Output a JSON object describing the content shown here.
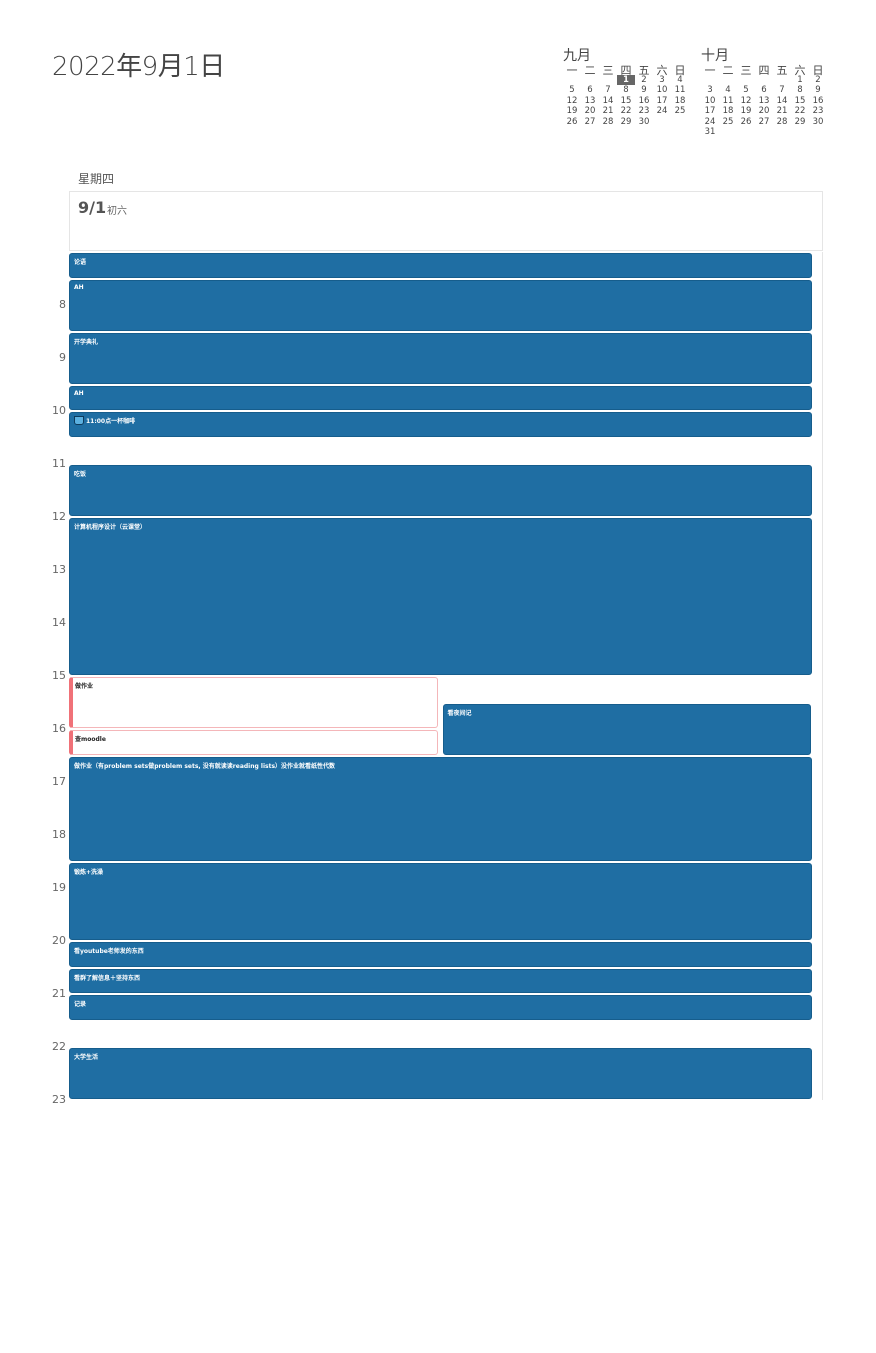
{
  "header": {
    "title": "2022年9月1日"
  },
  "mini_calendars": [
    {
      "title": "九月",
      "weekdays": [
        "一",
        "二",
        "三",
        "四",
        "五",
        "六",
        "日"
      ],
      "days": [
        "",
        "",
        "",
        "1",
        "2",
        "3",
        "4",
        "5",
        "6",
        "7",
        "8",
        "9",
        "10",
        "11",
        "12",
        "13",
        "14",
        "15",
        "16",
        "17",
        "18",
        "19",
        "20",
        "21",
        "22",
        "23",
        "24",
        "25",
        "26",
        "27",
        "28",
        "29",
        "30"
      ],
      "today": "1"
    },
    {
      "title": "十月",
      "weekdays": [
        "一",
        "二",
        "三",
        "四",
        "五",
        "六",
        "日"
      ],
      "days": [
        "",
        "",
        "",
        "",
        "",
        "1",
        "2",
        "3",
        "4",
        "5",
        "6",
        "7",
        "8",
        "9",
        "10",
        "11",
        "12",
        "13",
        "14",
        "15",
        "16",
        "17",
        "18",
        "19",
        "20",
        "21",
        "22",
        "23",
        "24",
        "25",
        "26",
        "27",
        "28",
        "29",
        "30",
        "31"
      ],
      "today": ""
    }
  ],
  "day": {
    "weekday": "星期四",
    "date": "9/1",
    "lunar": "初六"
  },
  "hours": [
    "8",
    "9",
    "10",
    "11",
    "12",
    "13",
    "14",
    "15",
    "16",
    "17",
    "18",
    "19",
    "20",
    "21",
    "22",
    "23"
  ],
  "events": [
    {
      "title": "论语",
      "style": "blue",
      "start": 7.0,
      "end": 7.5,
      "col": 0,
      "cols": 1
    },
    {
      "title": "AH",
      "style": "blue",
      "start": 7.5,
      "end": 8.5,
      "col": 0,
      "cols": 1
    },
    {
      "title": "开学典礼",
      "style": "blue",
      "start": 8.5,
      "end": 9.5,
      "col": 0,
      "cols": 1
    },
    {
      "title": "AH",
      "style": "blue",
      "start": 9.5,
      "end": 10.0,
      "col": 0,
      "cols": 1
    },
    {
      "title": "11:00点一杯咖啡",
      "style": "blue",
      "icon": "coffee-cup-icon",
      "start": 10.0,
      "end": 10.5,
      "col": 0,
      "cols": 1
    },
    {
      "title": "吃饭",
      "style": "blue",
      "start": 11.0,
      "end": 12.0,
      "col": 0,
      "cols": 1
    },
    {
      "title": "计算机程序设计（云课堂）",
      "style": "blue",
      "start": 12.0,
      "end": 15.0,
      "col": 0,
      "cols": 1
    },
    {
      "title": "做作业",
      "style": "white",
      "start": 15.0,
      "end": 16.0,
      "col": 0,
      "cols": 2
    },
    {
      "title": "查moodle",
      "style": "white",
      "start": 16.0,
      "end": 16.5,
      "col": 0,
      "cols": 2
    },
    {
      "title": "看夜间记",
      "style": "blue",
      "start": 15.5,
      "end": 16.5,
      "col": 1,
      "cols": 2
    },
    {
      "title": "做作业（有problem sets做problem sets, 没有就读读reading lists）没作业就看纸性代数",
      "style": "blue",
      "start": 16.5,
      "end": 18.5,
      "col": 0,
      "cols": 1
    },
    {
      "title": "锻炼+洗澡",
      "style": "blue",
      "start": 18.5,
      "end": 20.0,
      "col": 0,
      "cols": 1
    },
    {
      "title": "看youtube老师发的东西",
      "style": "blue",
      "start": 20.0,
      "end": 20.5,
      "col": 0,
      "cols": 1
    },
    {
      "title": "看群了解信息＋坚持东西",
      "style": "blue",
      "start": 20.5,
      "end": 21.0,
      "col": 0,
      "cols": 1
    },
    {
      "title": "记录",
      "style": "blue",
      "start": 21.0,
      "end": 21.5,
      "col": 0,
      "cols": 1
    },
    {
      "title": "大学生活",
      "style": "blue",
      "start": 22.0,
      "end": 23.0,
      "col": 0,
      "cols": 1
    }
  ],
  "colors": {
    "event_blue": "#1f6ea3",
    "todo_accent": "#f07178"
  }
}
